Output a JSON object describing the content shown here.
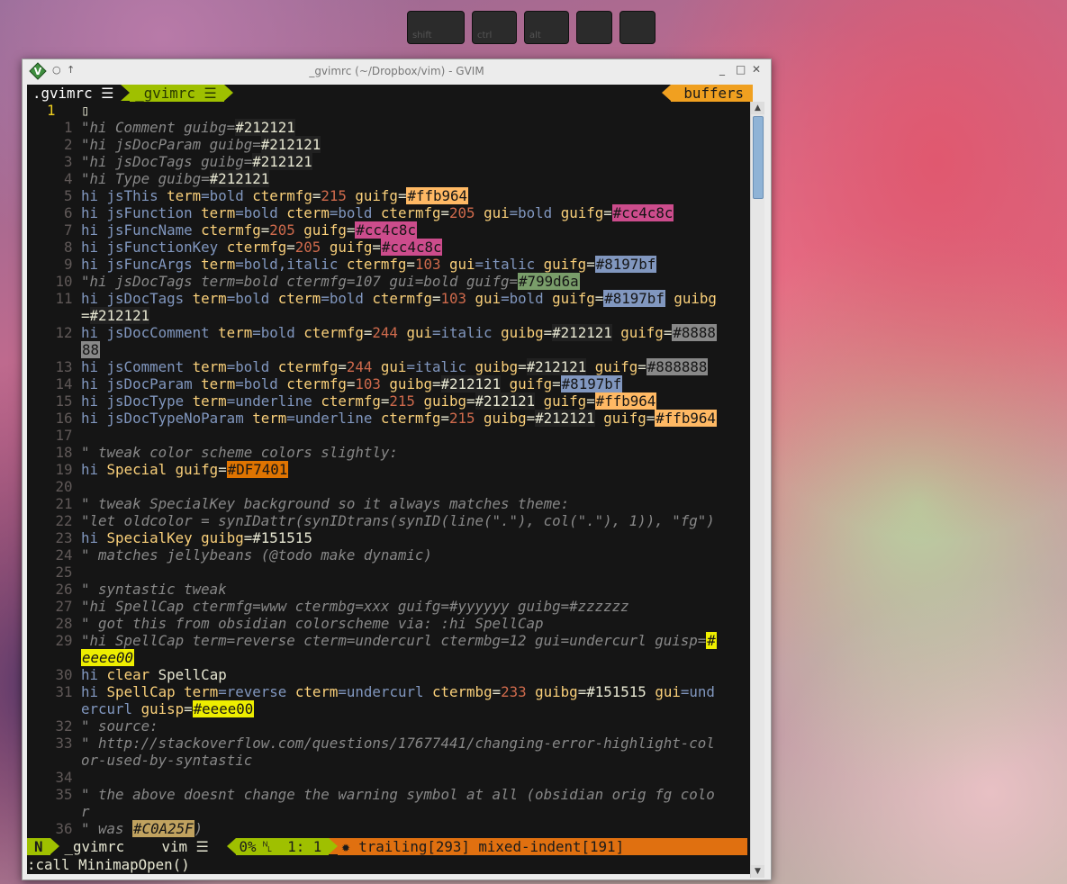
{
  "onscreen_keys": [
    "shift",
    "ctrl",
    "alt",
    "",
    ""
  ],
  "window": {
    "title": "_gvimrc (~/Dropbox/vim) - GVIM"
  },
  "tabline": {
    "tab1": ".gvimrc ☰",
    "tab2": "_gvimrc ☰",
    "buffers": "buffers"
  },
  "lines": [
    {
      "num": "1",
      "current": true,
      "segments": [
        {
          "t": "▯",
          "c": "op"
        }
      ]
    },
    {
      "num": "1",
      "segments": [
        {
          "t": "\"hi Comment guibg=",
          "c": "cm"
        },
        {
          "t": "#212121",
          "c": "op",
          "bg": "#212121"
        }
      ]
    },
    {
      "num": "2",
      "segments": [
        {
          "t": "\"hi jsDocParam guibg=",
          "c": "cm"
        },
        {
          "t": "#212121",
          "c": "op",
          "bg": "#212121"
        }
      ]
    },
    {
      "num": "3",
      "segments": [
        {
          "t": "\"hi jsDocTags guibg=",
          "c": "cm"
        },
        {
          "t": "#212121",
          "c": "op",
          "bg": "#212121"
        }
      ]
    },
    {
      "num": "4",
      "segments": [
        {
          "t": "\"hi Type guibg=",
          "c": "cm"
        },
        {
          "t": "#212121",
          "c": "op",
          "bg": "#212121"
        }
      ]
    },
    {
      "num": "5",
      "segments": [
        {
          "t": "hi ",
          "c": "kw"
        },
        {
          "t": "jsThis ",
          "c": "kw"
        },
        {
          "t": "term",
          "c": "id"
        },
        {
          "t": "=bold ",
          "c": "kw"
        },
        {
          "t": "ctermfg",
          "c": "id"
        },
        {
          "t": "=",
          "c": "op"
        },
        {
          "t": "215 ",
          "c": "num"
        },
        {
          "t": "guifg",
          "c": "id"
        },
        {
          "t": "=",
          "c": "op"
        },
        {
          "t": "#ffb964",
          "c": "hl",
          "bg": "#ffb964",
          "fg": "#151515"
        }
      ]
    },
    {
      "num": "6",
      "segments": [
        {
          "t": "hi jsFunction ",
          "c": "kw"
        },
        {
          "t": "term",
          "c": "id"
        },
        {
          "t": "=bold ",
          "c": "kw"
        },
        {
          "t": "cterm",
          "c": "id"
        },
        {
          "t": "=bold ",
          "c": "kw"
        },
        {
          "t": "ctermfg",
          "c": "id"
        },
        {
          "t": "=",
          "c": "op"
        },
        {
          "t": "205 ",
          "c": "num"
        },
        {
          "t": "gui",
          "c": "id"
        },
        {
          "t": "=bold ",
          "c": "kw"
        },
        {
          "t": "guifg",
          "c": "id"
        },
        {
          "t": "=",
          "c": "op"
        },
        {
          "t": "#cc4c8c",
          "c": "hl",
          "bg": "#cc4c8c",
          "fg": "#151515"
        }
      ]
    },
    {
      "num": "7",
      "segments": [
        {
          "t": "hi jsFuncName ",
          "c": "kw"
        },
        {
          "t": "ctermfg",
          "c": "id"
        },
        {
          "t": "=",
          "c": "op"
        },
        {
          "t": "205 ",
          "c": "num"
        },
        {
          "t": "guifg",
          "c": "id"
        },
        {
          "t": "=",
          "c": "op"
        },
        {
          "t": "#cc4c8c",
          "c": "hl",
          "bg": "#cc4c8c",
          "fg": "#151515"
        }
      ]
    },
    {
      "num": "8",
      "segments": [
        {
          "t": "hi jsFunctionKey ",
          "c": "kw"
        },
        {
          "t": "ctermfg",
          "c": "id"
        },
        {
          "t": "=",
          "c": "op"
        },
        {
          "t": "205 ",
          "c": "num"
        },
        {
          "t": "guifg",
          "c": "id"
        },
        {
          "t": "=",
          "c": "op"
        },
        {
          "t": "#cc4c8c",
          "c": "hl",
          "bg": "#cc4c8c",
          "fg": "#151515"
        }
      ]
    },
    {
      "num": "9",
      "segments": [
        {
          "t": "hi jsFuncArgs ",
          "c": "kw"
        },
        {
          "t": "term",
          "c": "id"
        },
        {
          "t": "=bold,italic ",
          "c": "kw"
        },
        {
          "t": "ctermfg",
          "c": "id"
        },
        {
          "t": "=",
          "c": "op"
        },
        {
          "t": "103 ",
          "c": "num"
        },
        {
          "t": "gui",
          "c": "id"
        },
        {
          "t": "=italic ",
          "c": "kw"
        },
        {
          "t": "guifg",
          "c": "id"
        },
        {
          "t": "=",
          "c": "op"
        },
        {
          "t": "#8197bf",
          "c": "hl",
          "bg": "#8197bf",
          "fg": "#151515"
        }
      ]
    },
    {
      "num": "10",
      "segments": [
        {
          "t": "\"hi jsDocTags term=bold ctermfg=107 gui=bold guifg=",
          "c": "cm"
        },
        {
          "t": "#799d6a",
          "c": "hl",
          "bg": "#799d6a",
          "fg": "#151515"
        }
      ]
    },
    {
      "num": "11",
      "segments": [
        {
          "t": "hi jsDocTags ",
          "c": "kw"
        },
        {
          "t": "term",
          "c": "id"
        },
        {
          "t": "=bold ",
          "c": "kw"
        },
        {
          "t": "cterm",
          "c": "id"
        },
        {
          "t": "=bold ",
          "c": "kw"
        },
        {
          "t": "ctermfg",
          "c": "id"
        },
        {
          "t": "=",
          "c": "op"
        },
        {
          "t": "103 ",
          "c": "num"
        },
        {
          "t": "gui",
          "c": "id"
        },
        {
          "t": "=bold ",
          "c": "kw"
        },
        {
          "t": "guifg",
          "c": "id"
        },
        {
          "t": "=",
          "c": "op"
        },
        {
          "t": "#8197bf",
          "c": "hl",
          "bg": "#8197bf",
          "fg": "#151515"
        },
        {
          "t": " guibg",
          "c": "id"
        }
      ]
    },
    {
      "num": "",
      "segments": [
        {
          "t": "=",
          "c": "op"
        },
        {
          "t": "#212121",
          "c": "op",
          "bg": "#212121"
        }
      ]
    },
    {
      "num": "12",
      "segments": [
        {
          "t": "hi jsDocComment ",
          "c": "kw"
        },
        {
          "t": "term",
          "c": "id"
        },
        {
          "t": "=bold ",
          "c": "kw"
        },
        {
          "t": "ctermfg",
          "c": "id"
        },
        {
          "t": "=",
          "c": "op"
        },
        {
          "t": "244 ",
          "c": "num"
        },
        {
          "t": "gui",
          "c": "id"
        },
        {
          "t": "=italic ",
          "c": "kw"
        },
        {
          "t": "guibg",
          "c": "id"
        },
        {
          "t": "=",
          "c": "op"
        },
        {
          "t": "#212121",
          "c": "op",
          "bg": "#212121"
        },
        {
          "t": " guifg",
          "c": "id"
        },
        {
          "t": "=",
          "c": "op"
        },
        {
          "t": "#8888",
          "c": "hl",
          "bg": "#888888",
          "fg": "#151515"
        }
      ]
    },
    {
      "num": "",
      "segments": [
        {
          "t": "88",
          "c": "hl",
          "bg": "#888888",
          "fg": "#151515"
        }
      ]
    },
    {
      "num": "13",
      "segments": [
        {
          "t": "hi jsComment ",
          "c": "kw"
        },
        {
          "t": "term",
          "c": "id"
        },
        {
          "t": "=bold ",
          "c": "kw"
        },
        {
          "t": "ctermfg",
          "c": "id"
        },
        {
          "t": "=",
          "c": "op"
        },
        {
          "t": "244 ",
          "c": "num"
        },
        {
          "t": "gui",
          "c": "id"
        },
        {
          "t": "=italic ",
          "c": "kw"
        },
        {
          "t": "guibg",
          "c": "id"
        },
        {
          "t": "=",
          "c": "op"
        },
        {
          "t": "#212121",
          "c": "op",
          "bg": "#212121"
        },
        {
          "t": " guifg",
          "c": "id"
        },
        {
          "t": "=",
          "c": "op"
        },
        {
          "t": "#888888",
          "c": "hl",
          "bg": "#888888",
          "fg": "#151515"
        }
      ]
    },
    {
      "num": "14",
      "segments": [
        {
          "t": "hi jsDocParam ",
          "c": "kw"
        },
        {
          "t": "term",
          "c": "id"
        },
        {
          "t": "=bold ",
          "c": "kw"
        },
        {
          "t": "ctermfg",
          "c": "id"
        },
        {
          "t": "=",
          "c": "op"
        },
        {
          "t": "103 ",
          "c": "num"
        },
        {
          "t": "guibg",
          "c": "id"
        },
        {
          "t": "=",
          "c": "op"
        },
        {
          "t": "#212121",
          "c": "op",
          "bg": "#212121"
        },
        {
          "t": " guifg",
          "c": "id"
        },
        {
          "t": "=",
          "c": "op"
        },
        {
          "t": "#8197bf",
          "c": "hl",
          "bg": "#8197bf",
          "fg": "#151515"
        }
      ]
    },
    {
      "num": "15",
      "segments": [
        {
          "t": "hi jsDocType ",
          "c": "kw"
        },
        {
          "t": "term",
          "c": "id"
        },
        {
          "t": "=underline ",
          "c": "kw"
        },
        {
          "t": "ctermfg",
          "c": "id"
        },
        {
          "t": "=",
          "c": "op"
        },
        {
          "t": "215 ",
          "c": "num"
        },
        {
          "t": "guibg",
          "c": "id"
        },
        {
          "t": "=",
          "c": "op"
        },
        {
          "t": "#212121",
          "c": "op",
          "bg": "#212121"
        },
        {
          "t": " guifg",
          "c": "id"
        },
        {
          "t": "=",
          "c": "op"
        },
        {
          "t": "#ffb964",
          "c": "hl",
          "bg": "#ffb964",
          "fg": "#151515"
        }
      ]
    },
    {
      "num": "16",
      "segments": [
        {
          "t": "hi jsDocTypeNoParam ",
          "c": "kw"
        },
        {
          "t": "term",
          "c": "id"
        },
        {
          "t": "=underline ",
          "c": "kw"
        },
        {
          "t": "ctermfg",
          "c": "id"
        },
        {
          "t": "=",
          "c": "op"
        },
        {
          "t": "215 ",
          "c": "num"
        },
        {
          "t": "guibg",
          "c": "id"
        },
        {
          "t": "=",
          "c": "op"
        },
        {
          "t": "#212121",
          "c": "op",
          "bg": "#212121"
        },
        {
          "t": " guifg",
          "c": "id"
        },
        {
          "t": "=",
          "c": "op"
        },
        {
          "t": "#ffb964",
          "c": "hl",
          "bg": "#ffb964",
          "fg": "#151515"
        }
      ]
    },
    {
      "num": "17",
      "segments": []
    },
    {
      "num": "18",
      "segments": [
        {
          "t": "\" tweak color scheme colors slightly:",
          "c": "cm"
        }
      ]
    },
    {
      "num": "19",
      "segments": [
        {
          "t": "hi ",
          "c": "kw"
        },
        {
          "t": "Special ",
          "c": "id"
        },
        {
          "t": "guifg",
          "c": "id"
        },
        {
          "t": "=",
          "c": "op"
        },
        {
          "t": "#DF7401",
          "c": "hl",
          "bg": "#DF7401",
          "fg": "#151515"
        }
      ]
    },
    {
      "num": "20",
      "segments": []
    },
    {
      "num": "21",
      "segments": [
        {
          "t": "\" tweak SpecialKey background so it always matches theme:",
          "c": "cm"
        }
      ]
    },
    {
      "num": "22",
      "segments": [
        {
          "t": "\"let oldcolor = synIDattr(synIDtrans(synID(line(\".\"), col(\".\"), 1)), \"fg\")",
          "c": "cm"
        }
      ]
    },
    {
      "num": "23",
      "segments": [
        {
          "t": "hi ",
          "c": "kw"
        },
        {
          "t": "SpecialKey ",
          "c": "id"
        },
        {
          "t": "guibg",
          "c": "id"
        },
        {
          "t": "=",
          "c": "op"
        },
        {
          "t": "#151515",
          "c": "op"
        }
      ]
    },
    {
      "num": "24",
      "segments": [
        {
          "t": "\" matches jellybeans (@todo make dynamic)",
          "c": "cm"
        }
      ]
    },
    {
      "num": "25",
      "segments": []
    },
    {
      "num": "26",
      "segments": [
        {
          "t": "\" syntastic tweak",
          "c": "cm"
        }
      ]
    },
    {
      "num": "27",
      "segments": [
        {
          "t": "\"hi SpellCap ctermfg=www ctermbg=xxx guifg=#yyyyyy guibg=#zzzzzz",
          "c": "cm"
        }
      ]
    },
    {
      "num": "28",
      "segments": [
        {
          "t": "\" got this from obsidian colorscheme via: :hi SpellCap",
          "c": "cm"
        }
      ]
    },
    {
      "num": "29",
      "segments": [
        {
          "t": "\"hi SpellCap term=reverse cterm=undercurl ctermbg=12 gui=undercurl guisp=",
          "c": "cm"
        },
        {
          "t": "#",
          "c": "hl",
          "bg": "#eeee00",
          "fg": "#151515"
        }
      ]
    },
    {
      "num": "",
      "segments": [
        {
          "t": "eeee00",
          "c": "hl",
          "bg": "#eeee00",
          "fg": "#151515",
          "it": true
        }
      ]
    },
    {
      "num": "30",
      "segments": [
        {
          "t": "hi ",
          "c": "kw"
        },
        {
          "t": "clear ",
          "c": "id"
        },
        {
          "t": "SpellCap",
          "c": "op"
        }
      ]
    },
    {
      "num": "31",
      "segments": [
        {
          "t": "hi ",
          "c": "kw"
        },
        {
          "t": "SpellCap ",
          "c": "id"
        },
        {
          "t": "term",
          "c": "id"
        },
        {
          "t": "=reverse ",
          "c": "kw"
        },
        {
          "t": "cterm",
          "c": "id"
        },
        {
          "t": "=undercurl ",
          "c": "kw"
        },
        {
          "t": "ctermbg",
          "c": "id"
        },
        {
          "t": "=",
          "c": "op"
        },
        {
          "t": "233 ",
          "c": "num"
        },
        {
          "t": "guibg",
          "c": "id"
        },
        {
          "t": "=",
          "c": "op"
        },
        {
          "t": "#151515 ",
          "c": "op"
        },
        {
          "t": "gui",
          "c": "id"
        },
        {
          "t": "=und",
          "c": "kw"
        }
      ]
    },
    {
      "num": "",
      "segments": [
        {
          "t": "ercurl ",
          "c": "kw"
        },
        {
          "t": "guisp",
          "c": "id"
        },
        {
          "t": "=",
          "c": "op"
        },
        {
          "t": "#eeee00",
          "c": "hl",
          "bg": "#eeee00",
          "fg": "#151515"
        }
      ]
    },
    {
      "num": "32",
      "segments": [
        {
          "t": "\" source:",
          "c": "cm"
        }
      ]
    },
    {
      "num": "33",
      "segments": [
        {
          "t": "\" http://stackoverflow.com/questions/17677441/changing-error-highlight-col",
          "c": "cm"
        }
      ]
    },
    {
      "num": "",
      "segments": [
        {
          "t": "or-used-by-syntastic",
          "c": "cm"
        }
      ]
    },
    {
      "num": "34",
      "segments": []
    },
    {
      "num": "35",
      "segments": [
        {
          "t": "\" the above doesnt change the warning symbol at all (obsidian orig fg colo",
          "c": "cm"
        }
      ]
    },
    {
      "num": "",
      "segments": [
        {
          "t": "r",
          "c": "cm"
        }
      ]
    },
    {
      "num": "36",
      "segments": [
        {
          "t": "\" was ",
          "c": "cm"
        },
        {
          "t": "#C0A25F",
          "c": "hl",
          "bg": "#C0A25F",
          "fg": "#151515",
          "it": true
        },
        {
          "t": ")",
          "c": "cm"
        }
      ]
    }
  ],
  "statusline": {
    "mode": "N",
    "file": "_gvimrc",
    "filetype": "vim ☰",
    "percent": "0%",
    "ln": "␤",
    "pos": "1:  1",
    "warnings": "✹ trailing[293] mixed-indent[191]"
  },
  "cmdline": ":call MinimapOpen()",
  "colors": {
    "mode_bg": "#9fc000",
    "warn_bg": "#e07010",
    "bg": "#151515"
  }
}
